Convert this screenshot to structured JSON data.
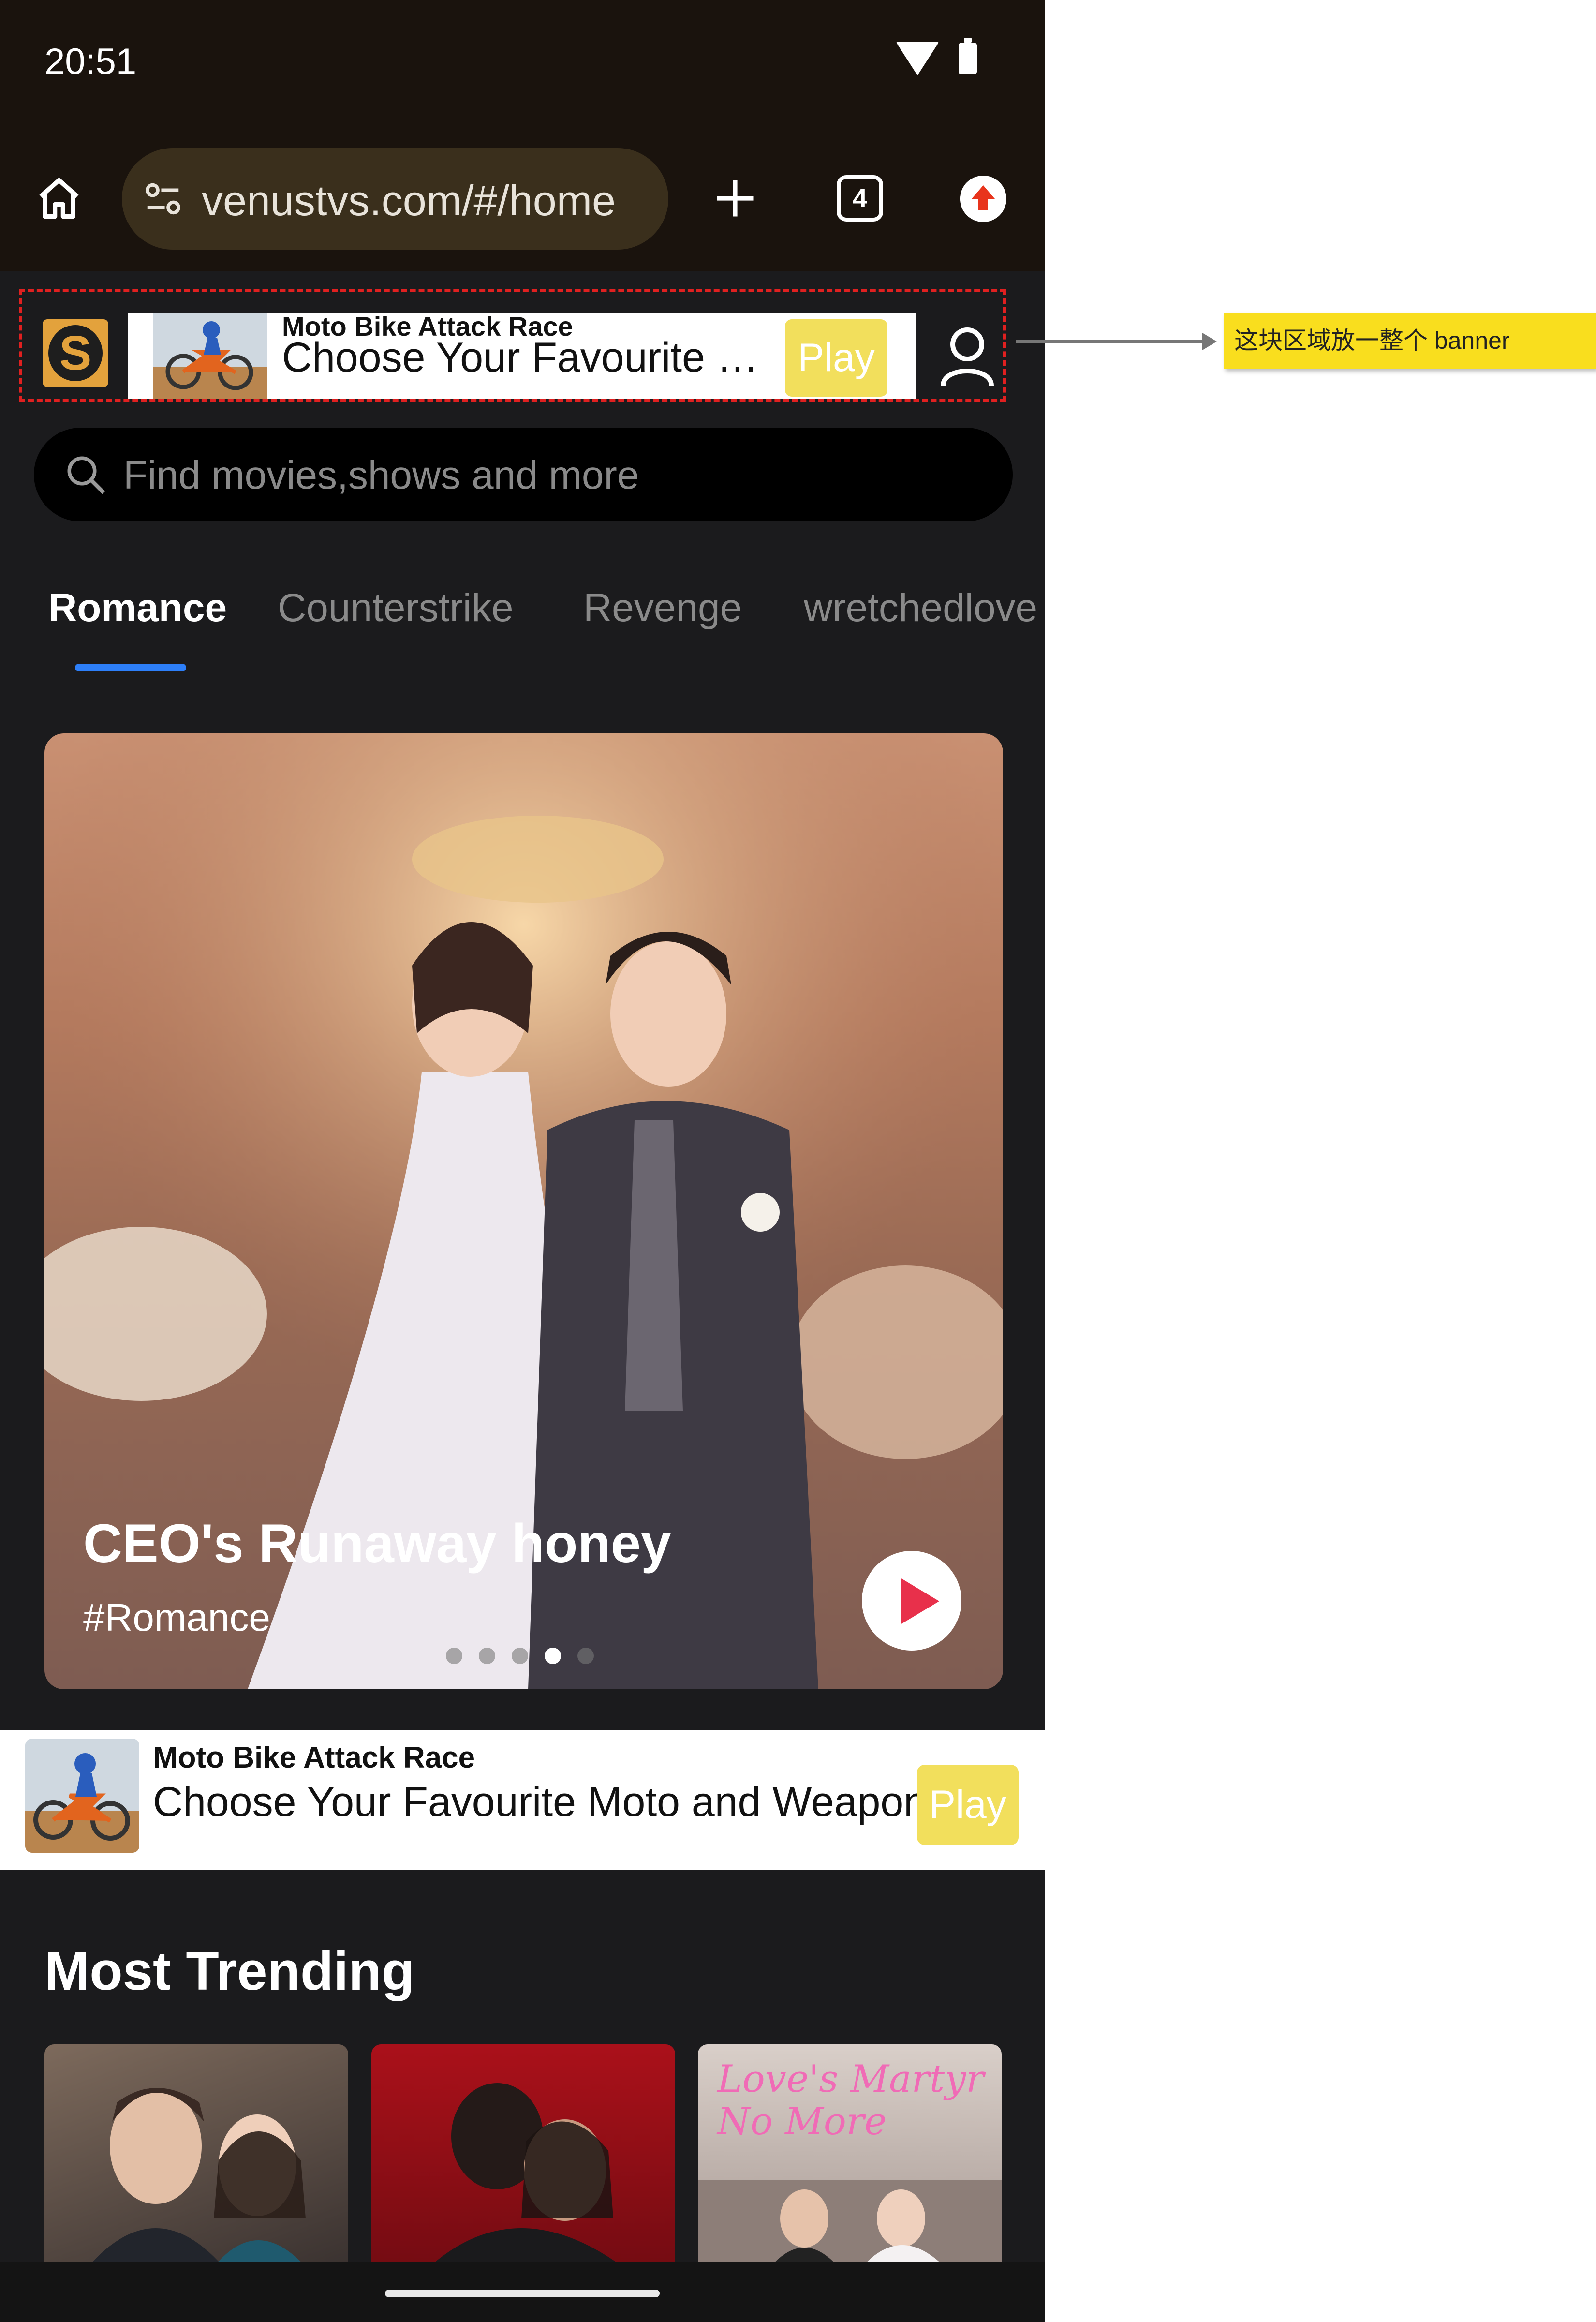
{
  "status_bar": {
    "time": "20:51"
  },
  "browser": {
    "url": "venustvs.com/#/home",
    "tab_count": "4"
  },
  "top_banner": {
    "app_title": "Moto Bike Attack Race",
    "headline": "Choose Your Favourite Mo…",
    "play_label": "Play",
    "logo_letter": "S"
  },
  "annotation": {
    "text": "这块区域放一整个 banner"
  },
  "search": {
    "placeholder": "Find movies,shows and more"
  },
  "tabs": [
    {
      "label": "Romance",
      "active": true
    },
    {
      "label": "Counterstrike",
      "active": false
    },
    {
      "label": "Revenge",
      "active": false
    },
    {
      "label": "wretchedlove",
      "active": false
    }
  ],
  "hero": {
    "title": "CEO's Runaway honey",
    "tag": "#Romance",
    "slide_count": 5,
    "active_slide": 4
  },
  "mid_ad": {
    "app_title": "Moto Bike Attack Race",
    "headline": "Choose Your Favourite Moto and Weapon!",
    "play_label": "Play"
  },
  "trending": {
    "title": "Most Trending",
    "posters": [
      {
        "caption": ""
      },
      {
        "caption": ""
      },
      {
        "caption": "Love's Martyr No More"
      }
    ]
  },
  "colors": {
    "accent": "#2d7ff9",
    "play_red": "#e8304b",
    "ad_button": "#f2df5c",
    "annotation_bg": "#f9de1e",
    "banner_border": "#e02020"
  }
}
